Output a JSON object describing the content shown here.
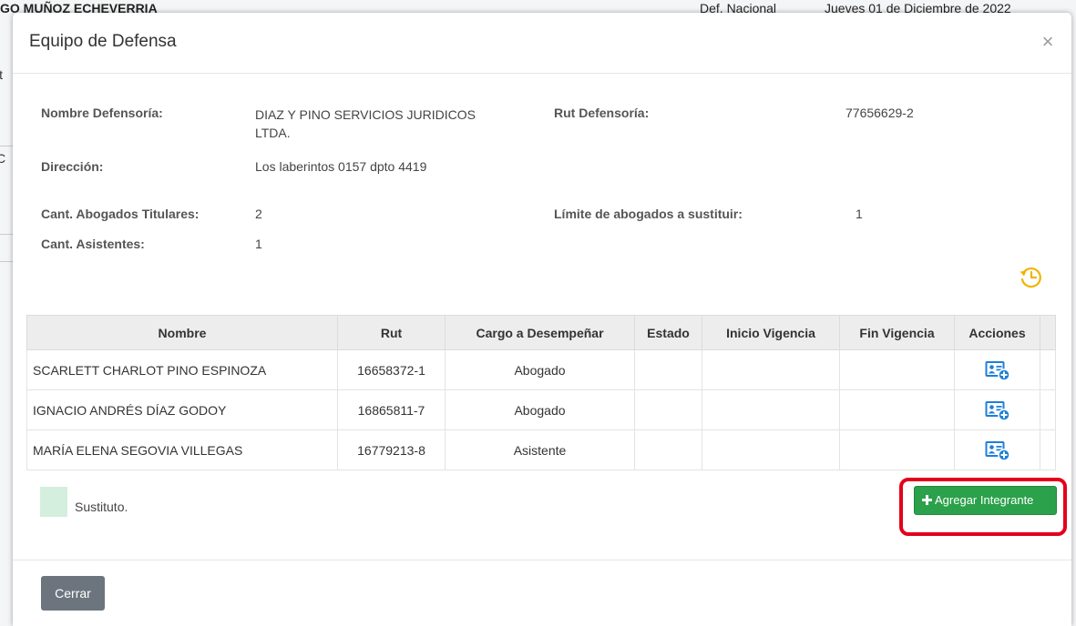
{
  "background": {
    "header_name": "GO MUÑOZ ECHEVERRIA",
    "header_rol": "Def. Nacional",
    "header_date": "Jueves 01 de Diciembre de 2022",
    "frag_1": "it",
    "frag_2": "C"
  },
  "modal": {
    "title": "Equipo de Defensa",
    "close_symbol": "×"
  },
  "info": {
    "nombre_label": "Nombre Defensoría:",
    "nombre_value": "DIAZ Y PINO SERVICIOS JURIDICOS LTDA.",
    "rut_label": "Rut Defensoría:",
    "rut_value": "77656629-2",
    "direccion_label": "Dirección:",
    "direccion_value": "Los laberintos 0157 dpto 4419",
    "abogados_label": "Cant. Abogados Titulares:",
    "abogados_value": "2",
    "limite_label": "Límite de abogados a sustituir:",
    "limite_value": "1",
    "asistentes_label": "Cant. Asistentes:",
    "asistentes_value": "1"
  },
  "table": {
    "headers": [
      "Nombre",
      "Rut",
      "Cargo a Desempeñar",
      "Estado",
      "Inicio Vigencia",
      "Fin Vigencia",
      "Acciones"
    ],
    "rows": [
      {
        "nombre": "SCARLETT CHARLOT PINO ESPINOZA",
        "rut": "16658372-1",
        "cargo": "Abogado",
        "estado": "",
        "inicio": "",
        "fin": ""
      },
      {
        "nombre": "IGNACIO ANDRÉS DÍAZ GODOY",
        "rut": "16865811-7",
        "cargo": "Abogado",
        "estado": "",
        "inicio": "",
        "fin": ""
      },
      {
        "nombre": "MARÍA ELENA SEGOVIA VILLEGAS",
        "rut": "16779213-8",
        "cargo": "Asistente",
        "estado": "",
        "inicio": "",
        "fin": ""
      }
    ]
  },
  "legend": {
    "sustituto_label": "Sustituto."
  },
  "actions": {
    "add_label": "Agregar Integrante",
    "close_label": "Cerrar"
  },
  "icons": {
    "history": "history-clock-icon",
    "row_action": "add-user-card-icon",
    "add": "plus-icon"
  },
  "colors": {
    "add_button": "#2aa14a",
    "highlight": "#e3001b",
    "history_icon": "#f0b400",
    "action_icon": "#1e7fd8",
    "sustituto_swatch": "#d4efdd",
    "close_button": "#6c757d"
  }
}
